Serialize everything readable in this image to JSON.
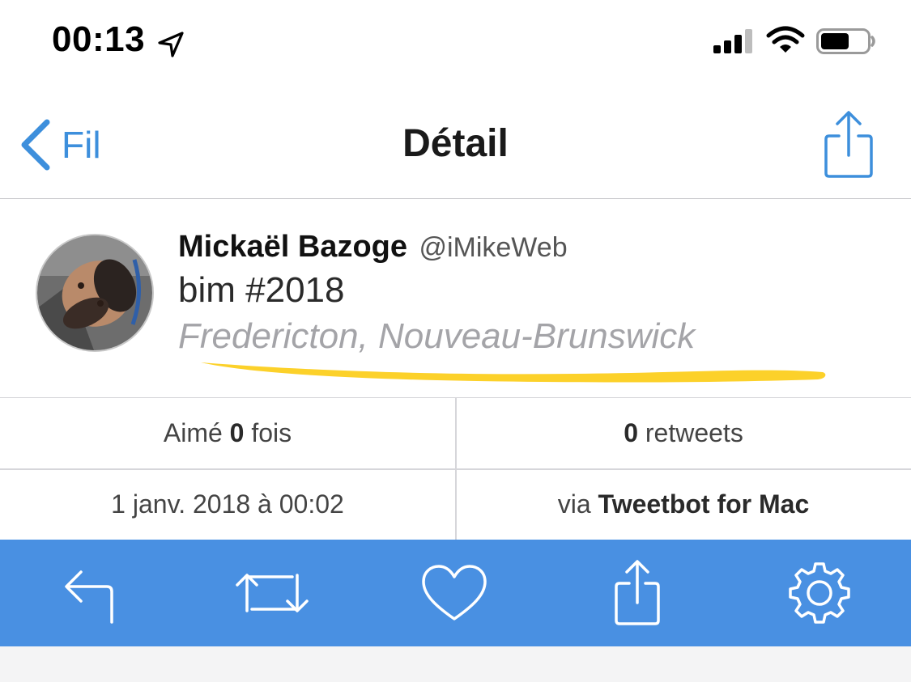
{
  "status_bar": {
    "time": "00:13",
    "icons": [
      "location-arrow-icon",
      "cellular-signal-icon",
      "wifi-icon",
      "battery-icon"
    ]
  },
  "nav": {
    "back_label": "Fil",
    "title": "Détail",
    "share_icon": "share-icon"
  },
  "tweet": {
    "author_name": "Mickaël Bazoge",
    "author_handle": "@iMikeWeb",
    "text": "bim #2018",
    "location": "Fredericton, Nouveau-Brunswick",
    "highlight_color": "#fcd12a"
  },
  "stats": {
    "likes_prefix": "Aimé",
    "likes_count": "0",
    "likes_suffix": "fois",
    "retweets_count": "0",
    "retweets_label": "retweets",
    "date": "1 janv. 2018 à 00:02",
    "via_prefix": "via",
    "client": "Tweetbot for Mac"
  },
  "toolbar": {
    "items": [
      "reply-icon",
      "retweet-icon",
      "heart-icon",
      "share-icon",
      "gear-icon"
    ],
    "background": "#4990e2"
  },
  "colors": {
    "accent": "#3d8fdc",
    "muted_text": "#a4a4a8"
  }
}
